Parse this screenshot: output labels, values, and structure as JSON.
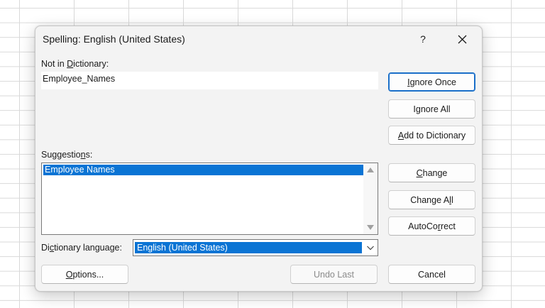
{
  "dialog": {
    "title": "Spelling: English (United States)",
    "help_label": "?",
    "close_icon": "close-icon"
  },
  "not_in_dictionary": {
    "label_pre": "Not in ",
    "label_mnemonic": "D",
    "label_post": "ictionary:",
    "value": "Employee_Names"
  },
  "suggestions": {
    "label_pre": "Suggestio",
    "label_mnemonic": "n",
    "label_post": "s:",
    "items": [
      "Employee Names"
    ]
  },
  "dictionary_language": {
    "label_pre": "Di",
    "label_mnemonic": "c",
    "label_post": "tionary language:",
    "value": "English (United States)"
  },
  "buttons": {
    "ignore_once": {
      "pre": "",
      "m": "I",
      "post": "gnore Once"
    },
    "ignore_all": {
      "pre": "I",
      "m": "g",
      "post": "nore All"
    },
    "add_to_dictionary": {
      "pre": "",
      "m": "A",
      "post": "dd to Dictionary"
    },
    "change": {
      "pre": "",
      "m": "C",
      "post": "hange"
    },
    "change_all": {
      "pre": "Change A",
      "m": "l",
      "post": "l"
    },
    "autocorrect": {
      "pre": "AutoCo",
      "m": "r",
      "post": "rect"
    },
    "options": {
      "pre": "",
      "m": "O",
      "post": "ptions..."
    },
    "undo_last": {
      "pre": "",
      "m": "",
      "post": "Undo Last"
    },
    "cancel": {
      "pre": "",
      "m": "",
      "post": "Cancel"
    }
  },
  "colors": {
    "selection": "#0a74d4",
    "dialog_bg": "#f3f3f3",
    "primary_border": "#1a6fc9"
  }
}
